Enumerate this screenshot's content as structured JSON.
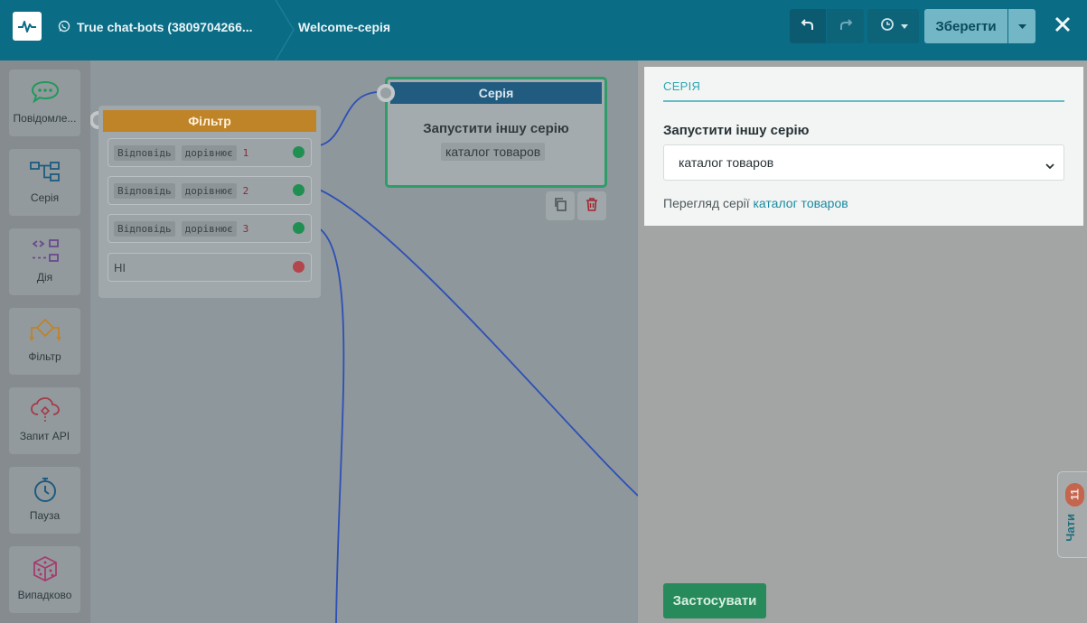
{
  "header": {
    "bot_name": "True chat-bots (3809704266...",
    "flow_name": "Welcome-серія",
    "save_label": "Зберегти",
    "icons": [
      "app-logo-icon",
      "whatsapp-icon",
      "undo-icon",
      "redo-icon",
      "history-icon",
      "caret-down-icon",
      "close-icon"
    ]
  },
  "palette": {
    "items": [
      {
        "label": "Повідомле...",
        "icon": "message-icon",
        "color": "#1f9a5b"
      },
      {
        "label": "Серія",
        "icon": "series-flow-icon",
        "color": "#1d5b80"
      },
      {
        "label": "Дія",
        "icon": "action-icon",
        "color": "#6a4a8c"
      },
      {
        "label": "Фільтр",
        "icon": "filter-icon",
        "color": "#bf8328"
      },
      {
        "label": "Запит API",
        "icon": "api-cloud-icon",
        "color": "#a63a4a"
      },
      {
        "label": "Пауза",
        "icon": "stopwatch-icon",
        "color": "#1d5b80"
      },
      {
        "label": "Випадково",
        "icon": "dice-icon",
        "color": "#a63a6e"
      }
    ]
  },
  "canvas": {
    "filter_node": {
      "title": "Фільтр",
      "conditions": [
        {
          "field": "Відповідь",
          "operator": "дорівнює",
          "value": "1"
        },
        {
          "field": "Відповідь",
          "operator": "дорівнює",
          "value": "2"
        },
        {
          "field": "Відповідь",
          "operator": "дорівнює",
          "value": "3"
        }
      ],
      "else_label": "НІ"
    },
    "series_node": {
      "title": "Серія",
      "action": "Запустити іншу серію",
      "target": "каталог товаров"
    }
  },
  "panel": {
    "tab": "СЕРІЯ",
    "field_label": "Запустити іншу серію",
    "selected_series": "каталог товаров",
    "preview_prefix": "Перегляд серії",
    "preview_link": "каталог товаров",
    "apply_label": "Застосувати"
  },
  "chats": {
    "label": "Чати",
    "badge": "11"
  },
  "colors": {
    "header_bg": "#0a6c85",
    "filter_accent": "#bf8328",
    "series_accent": "#215c80",
    "active_border": "#2f9c6a",
    "apply_button": "#278a5a",
    "link": "#1a8aa0",
    "badge": "#c4654e"
  }
}
